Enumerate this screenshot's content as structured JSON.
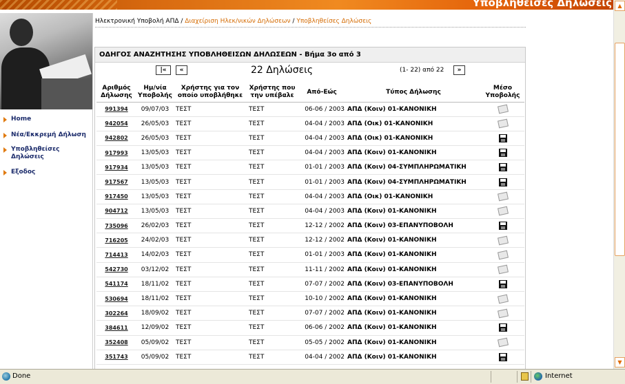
{
  "banner": {
    "title": "Υποβληθείσες Δηλώσεις"
  },
  "nav": [
    {
      "label": "Home"
    },
    {
      "label": "Νέα/Εκκρεμή Δήλωση"
    },
    {
      "label": "Υποβληθείσες Δηλώσεις"
    },
    {
      "label": "Εξοδος"
    }
  ],
  "breadcrumb": {
    "home": "Ηλεκτρονική Υποβολή ΑΠΔ",
    "sep": "/",
    "level1": "Διαχείριση Ηλεκ/νικών Δηλώσεων",
    "level2": "Υποβληθείσες Δηλώσεις"
  },
  "panel": {
    "title": "ΟΔΗΓΟΣ ΑΝΑΖΗΤΗΣΗΣ ΥΠΟΒΛΗΘΕΙΣΩΝ ΔΗΛΩΣΕΩΝ - Βήμα 3ο από 3",
    "first_btn": "|«",
    "prev_btn": "«",
    "count_label": "22 Δηλώσεις",
    "range_label": "(1- 22) από 22",
    "next_btn": "»"
  },
  "columns": [
    "Αριθμός Δήλωσης",
    "Ημ/νία Υποβολής",
    "Χρήστης για τον οποίο υποβλήθηκε",
    "Χρήστης που την υπέβαλε",
    "Από-Εώς",
    "Τύπος Δήλωσης",
    "Μέσο Υποβολής"
  ],
  "rows": [
    {
      "num": "991394",
      "date": "09/07/03",
      "for_user": "ΤΕΣΤ",
      "by_user": "ΤΕΣΤ",
      "period": "06-06 / 2003",
      "type": "ΑΠΔ (Κοιν) 01-ΚΑΝΟΝΙΚΗ",
      "mode": "doc"
    },
    {
      "num": "942054",
      "date": "26/05/03",
      "for_user": "ΤΕΣΤ",
      "by_user": "ΤΕΣΤ",
      "period": "04-04 / 2003",
      "type": "ΑΠΔ (Οικ) 01-ΚΑΝΟΝΙΚΗ",
      "mode": "doc"
    },
    {
      "num": "942802",
      "date": "26/05/03",
      "for_user": "ΤΕΣΤ",
      "by_user": "ΤΕΣΤ",
      "period": "04-04 / 2003",
      "type": "ΑΠΔ (Οικ) 01-ΚΑΝΟΝΙΚΗ",
      "mode": "floppy"
    },
    {
      "num": "917993",
      "date": "13/05/03",
      "for_user": "ΤΕΣΤ",
      "by_user": "ΤΕΣΤ",
      "period": "04-04 / 2003",
      "type": "ΑΠΔ (Κοιν) 01-ΚΑΝΟΝΙΚΗ",
      "mode": "floppy"
    },
    {
      "num": "917934",
      "date": "13/05/03",
      "for_user": "ΤΕΣΤ",
      "by_user": "ΤΕΣΤ",
      "period": "01-01 / 2003",
      "type": "ΑΠΔ (Κοιν) 04-ΣΥΜΠΛΗΡΩΜΑΤΙΚΗ",
      "mode": "floppy"
    },
    {
      "num": "917567",
      "date": "13/05/03",
      "for_user": "ΤΕΣΤ",
      "by_user": "ΤΕΣΤ",
      "period": "01-01 / 2003",
      "type": "ΑΠΔ (Κοιν) 04-ΣΥΜΠΛΗΡΩΜΑΤΙΚΗ",
      "mode": "floppy"
    },
    {
      "num": "917450",
      "date": "13/05/03",
      "for_user": "ΤΕΣΤ",
      "by_user": "ΤΕΣΤ",
      "period": "04-04 / 2003",
      "type": "ΑΠΔ (Οικ) 01-ΚΑΝΟΝΙΚΗ",
      "mode": "doc"
    },
    {
      "num": "904712",
      "date": "13/05/03",
      "for_user": "ΤΕΣΤ",
      "by_user": "ΤΕΣΤ",
      "period": "04-04 / 2003",
      "type": "ΑΠΔ (Κοιν) 01-ΚΑΝΟΝΙΚΗ",
      "mode": "doc"
    },
    {
      "num": "735096",
      "date": "26/02/03",
      "for_user": "ΤΕΣΤ",
      "by_user": "ΤΕΣΤ",
      "period": "12-12 / 2002",
      "type": "ΑΠΔ (Κοιν) 03-ΕΠΑΝΥΠΟΒΟΛΗ",
      "mode": "floppy"
    },
    {
      "num": "716205",
      "date": "24/02/03",
      "for_user": "ΤΕΣΤ",
      "by_user": "ΤΕΣΤ",
      "period": "12-12 / 2002",
      "type": "ΑΠΔ (Κοιν) 01-ΚΑΝΟΝΙΚΗ",
      "mode": "doc"
    },
    {
      "num": "714413",
      "date": "14/02/03",
      "for_user": "ΤΕΣΤ",
      "by_user": "ΤΕΣΤ",
      "period": "01-01 / 2003",
      "type": "ΑΠΔ (Κοιν) 01-ΚΑΝΟΝΙΚΗ",
      "mode": "doc"
    },
    {
      "num": "542730",
      "date": "03/12/02",
      "for_user": "ΤΕΣΤ",
      "by_user": "ΤΕΣΤ",
      "period": "11-11 / 2002",
      "type": "ΑΠΔ (Κοιν) 01-ΚΑΝΟΝΙΚΗ",
      "mode": "doc"
    },
    {
      "num": "541174",
      "date": "18/11/02",
      "for_user": "ΤΕΣΤ",
      "by_user": "ΤΕΣΤ",
      "period": "07-07 / 2002",
      "type": "ΑΠΔ (Κοιν) 03-ΕΠΑΝΥΠΟΒΟΛΗ",
      "mode": "floppy"
    },
    {
      "num": "530694",
      "date": "18/11/02",
      "for_user": "ΤΕΣΤ",
      "by_user": "ΤΕΣΤ",
      "period": "10-10 / 2002",
      "type": "ΑΠΔ (Κοιν) 01-ΚΑΝΟΝΙΚΗ",
      "mode": "doc"
    },
    {
      "num": "302264",
      "date": "18/09/02",
      "for_user": "ΤΕΣΤ",
      "by_user": "ΤΕΣΤ",
      "period": "07-07 / 2002",
      "type": "ΑΠΔ (Κοιν) 01-ΚΑΝΟΝΙΚΗ",
      "mode": "doc"
    },
    {
      "num": "384611",
      "date": "12/09/02",
      "for_user": "ΤΕΣΤ",
      "by_user": "ΤΕΣΤ",
      "period": "06-06 / 2002",
      "type": "ΑΠΔ (Κοιν) 01-ΚΑΝΟΝΙΚΗ",
      "mode": "floppy"
    },
    {
      "num": "352408",
      "date": "05/09/02",
      "for_user": "ΤΕΣΤ",
      "by_user": "ΤΕΣΤ",
      "period": "05-05 / 2002",
      "type": "ΑΠΔ (Κοιν) 01-ΚΑΝΟΝΙΚΗ",
      "mode": "doc"
    },
    {
      "num": "351743",
      "date": "05/09/02",
      "for_user": "ΤΕΣΤ",
      "by_user": "ΤΕΣΤ",
      "period": "04-04 / 2002",
      "type": "ΑΠΔ (Κοιν) 01-ΚΑΝΟΝΙΚΗ",
      "mode": "floppy"
    }
  ],
  "statusbar": {
    "status": "Done",
    "zone": "Internet"
  }
}
